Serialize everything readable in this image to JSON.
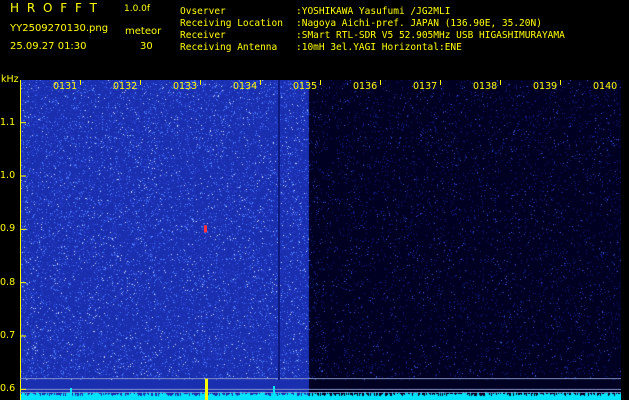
{
  "header": {
    "logo_letters": "H R O F F T",
    "version": "1.0.0f",
    "filename": "YY2509270130.png",
    "datetime": "25.09.27 01:30",
    "meteor_label": "meteor",
    "meteor_count": "30",
    "info": [
      {
        "label": "Ovserver",
        "value": ":YOSHIKAWA Yasufumi /JG2MLI"
      },
      {
        "label": "Receiving Location",
        "value": ":Nagoya Aichi-pref. JAPAN (136.90E, 35.20N)"
      },
      {
        "label": "Receiver",
        "value": ":SMart RTL-SDR V5 52.905MHz USB HIGASHIMURAYAMA"
      },
      {
        "label": "Receiving Antenna",
        "value": ":10mH 3el.YAGI Horizontal:ENE"
      }
    ]
  },
  "chart_data": {
    "type": "heatmap",
    "ylabel": "kHz",
    "y_ticks": [
      "1.1",
      "1.0",
      "0.9",
      "0.8",
      "0.7",
      "0.6"
    ],
    "x_ticks": [
      "0131",
      "0132",
      "0133",
      "0134",
      "0135",
      "0136",
      "0137",
      "0138",
      "0139",
      "0140"
    ],
    "ylim": [
      0.58,
      1.18
    ],
    "colors": {
      "active_bg": "#1a2fb0",
      "quiet_bg": "#000022",
      "noise": "#4a7dff",
      "spectrum": "#00e5ff",
      "meteor_mark": "#ff3040",
      "peak": "#ffff00",
      "axis": "#ffff00"
    }
  }
}
